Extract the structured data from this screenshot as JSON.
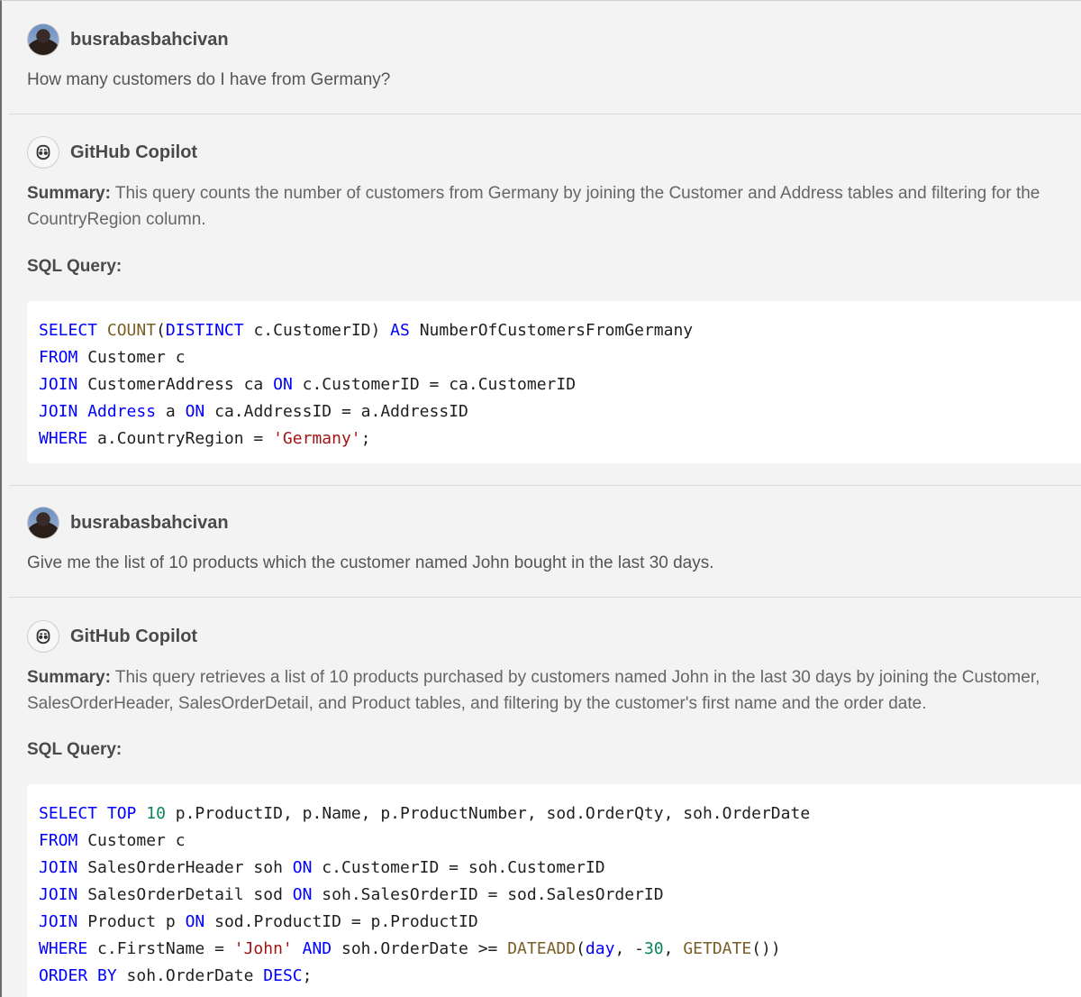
{
  "conversation": [
    {
      "role": "user",
      "author": "busrabasbahcivan",
      "text": "How many customers do I have from Germany?"
    },
    {
      "role": "assistant",
      "author": "GitHub Copilot",
      "summary_label": "Summary:",
      "summary": "This query counts the number of customers from Germany by joining the Customer and Address tables and filtering for the CountryRegion column.",
      "sql_label": "SQL Query:",
      "code_lines": [
        [
          [
            "kw",
            "SELECT"
          ],
          [
            "t",
            " "
          ],
          [
            "fn",
            "COUNT"
          ],
          [
            "t",
            "("
          ],
          [
            "kw",
            "DISTINCT"
          ],
          [
            "t",
            " c.CustomerID) "
          ],
          [
            "kw",
            "AS"
          ],
          [
            "t",
            " NumberOfCustomersFromGermany"
          ]
        ],
        [
          [
            "kw",
            "FROM"
          ],
          [
            "t",
            " Customer c"
          ]
        ],
        [
          [
            "kw",
            "JOIN"
          ],
          [
            "t",
            " CustomerAddress ca "
          ],
          [
            "kw",
            "ON"
          ],
          [
            "t",
            " c.CustomerID = ca.CustomerID"
          ]
        ],
        [
          [
            "kw",
            "JOIN"
          ],
          [
            "t",
            " "
          ],
          [
            "kw",
            "Address"
          ],
          [
            "t",
            " a "
          ],
          [
            "kw",
            "ON"
          ],
          [
            "t",
            " ca.AddressID = a.AddressID"
          ]
        ],
        [
          [
            "kw",
            "WHERE"
          ],
          [
            "t",
            " a.CountryRegion = "
          ],
          [
            "str",
            "'Germany'"
          ],
          [
            "t",
            ";"
          ]
        ]
      ]
    },
    {
      "role": "user",
      "author": "busrabasbahcivan",
      "text": "Give me the list of 10 products which the customer named John bought in the last 30 days."
    },
    {
      "role": "assistant",
      "author": "GitHub Copilot",
      "summary_label": "Summary:",
      "summary": "This query retrieves a list of 10 products purchased by customers named John in the last 30 days by joining the Customer, SalesOrderHeader, SalesOrderDetail, and Product tables, and filtering by the customer's first name and the order date.",
      "sql_label": "SQL Query:",
      "code_lines": [
        [
          [
            "kw",
            "SELECT"
          ],
          [
            "t",
            " "
          ],
          [
            "kw",
            "TOP"
          ],
          [
            "t",
            " "
          ],
          [
            "num",
            "10"
          ],
          [
            "t",
            " p.ProductID, p.Name, p.ProductNumber, sod.OrderQty, soh.OrderDate"
          ]
        ],
        [
          [
            "kw",
            "FROM"
          ],
          [
            "t",
            " Customer c"
          ]
        ],
        [
          [
            "kw",
            "JOIN"
          ],
          [
            "t",
            " SalesOrderHeader soh "
          ],
          [
            "kw",
            "ON"
          ],
          [
            "t",
            " c.CustomerID = soh.CustomerID"
          ]
        ],
        [
          [
            "kw",
            "JOIN"
          ],
          [
            "t",
            " SalesOrderDetail sod "
          ],
          [
            "kw",
            "ON"
          ],
          [
            "t",
            " soh.SalesOrderID = sod.SalesOrderID"
          ]
        ],
        [
          [
            "kw",
            "JOIN"
          ],
          [
            "t",
            " Product p "
          ],
          [
            "kw",
            "ON"
          ],
          [
            "t",
            " sod.ProductID = p.ProductID"
          ]
        ],
        [
          [
            "kw",
            "WHERE"
          ],
          [
            "t",
            " c.FirstName = "
          ],
          [
            "str",
            "'John'"
          ],
          [
            "t",
            " "
          ],
          [
            "kw",
            "AND"
          ],
          [
            "t",
            " soh.OrderDate >= "
          ],
          [
            "fn",
            "DATEADD"
          ],
          [
            "t",
            "("
          ],
          [
            "kw",
            "day"
          ],
          [
            "t",
            ", -"
          ],
          [
            "num",
            "30"
          ],
          [
            "t",
            ", "
          ],
          [
            "fn",
            "GETDATE"
          ],
          [
            "t",
            "())"
          ]
        ],
        [
          [
            "kw",
            "ORDER BY"
          ],
          [
            "t",
            " soh.OrderDate "
          ],
          [
            "kw",
            "DESC"
          ],
          [
            "t",
            ";"
          ]
        ]
      ]
    }
  ]
}
